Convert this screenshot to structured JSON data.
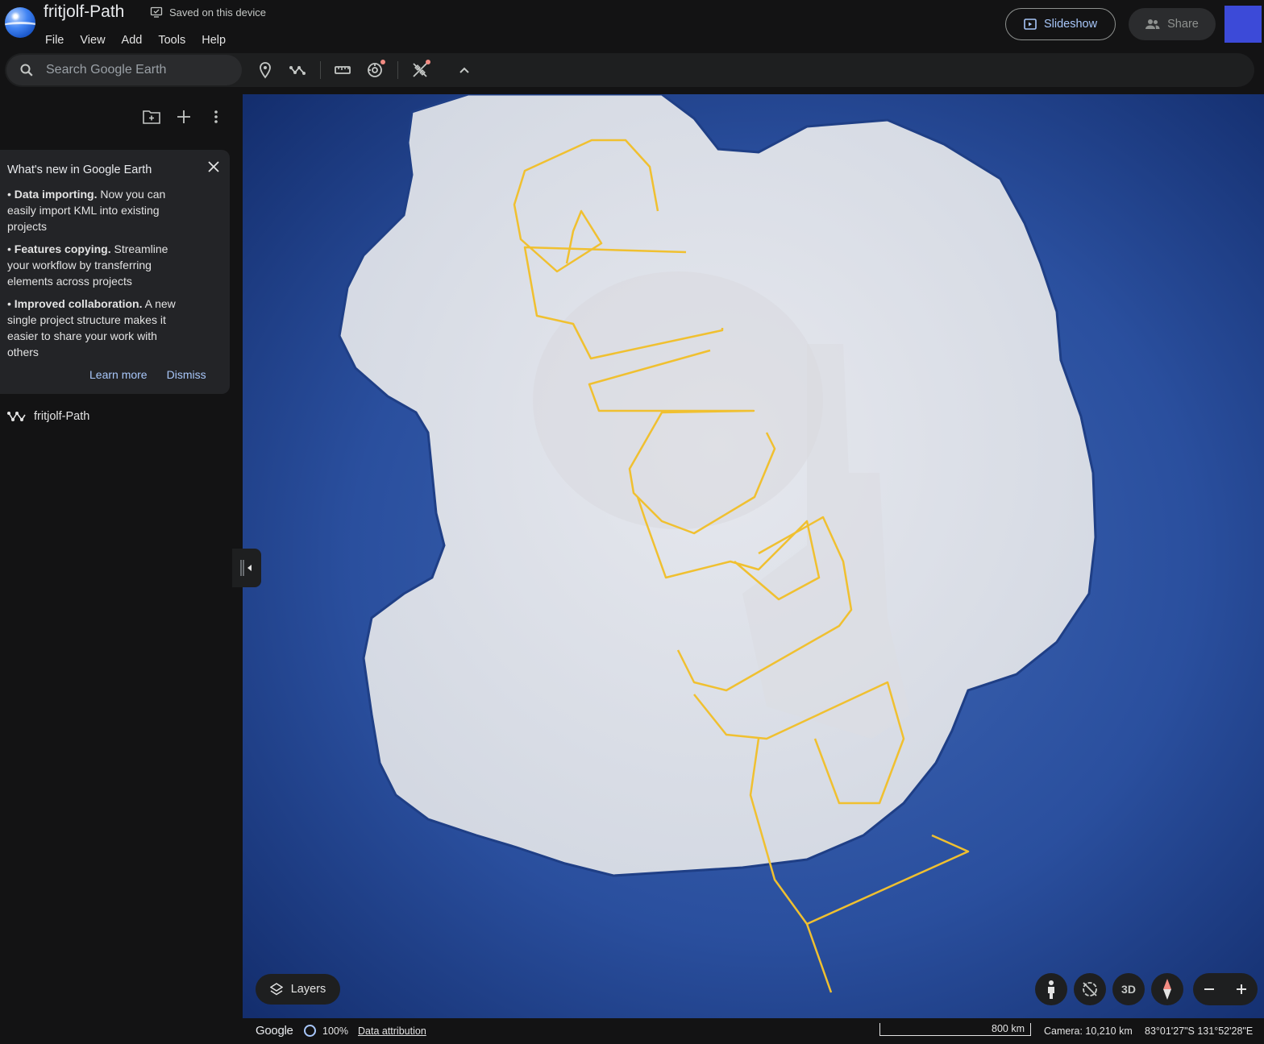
{
  "app": {
    "project_title": "fritjolf-Path",
    "saved_status": "Saved on this device"
  },
  "menu": [
    "File",
    "View",
    "Add",
    "Tools",
    "Help"
  ],
  "header_buttons": {
    "slideshow": "Slideshow",
    "share": "Share"
  },
  "accent_color": "#a8c7fa",
  "search": {
    "placeholder": "Search Google Earth"
  },
  "toolbar_icons": [
    "place-marker-icon",
    "path-icon",
    "ruler-icon",
    "voyager-icon",
    "tools-icon",
    "collapse-chevron-icon"
  ],
  "whats_new": {
    "title": "What's new in Google Earth",
    "items": [
      {
        "bold": "Data importing.",
        "text": " Now you can easily import KML into existing projects"
      },
      {
        "bold": "Features copying.",
        "text": " Streamline your workflow by transferring elements across projects"
      },
      {
        "bold": "Improved collaboration.",
        "text": " A new single project structure makes it easier to share your work with others"
      }
    ],
    "learn_more": "Learn more",
    "dismiss": "Dismiss"
  },
  "project_items": [
    {
      "label": "fritjolf-Path",
      "icon": "path-icon"
    }
  ],
  "map": {
    "path_color": "#f0c030",
    "layers_label": "Layers",
    "three_d_label": "3D"
  },
  "status": {
    "google_label": "Google",
    "load_percent": "100%",
    "data_attribution": "Data attribution",
    "scale": "800 km",
    "camera": "Camera: 10,210 km",
    "coordinates": "83°01'27\"S 131°52'28\"E"
  }
}
